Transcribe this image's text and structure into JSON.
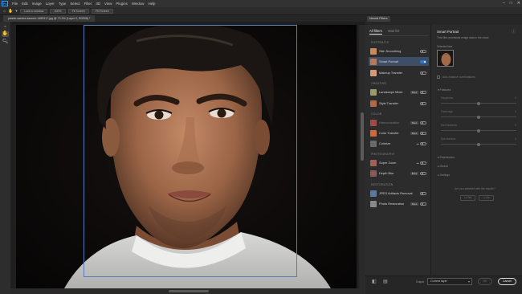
{
  "menubar": {
    "items": [
      "File",
      "Edit",
      "Image",
      "Layer",
      "Type",
      "Select",
      "Filter",
      "3D",
      "View",
      "Plugins",
      "Window",
      "Help"
    ]
  },
  "optionsbar": {
    "buttons": [
      "Lock to window",
      "100%",
      "Fit Screen",
      "Fill Screen"
    ]
  },
  "document": {
    "tab_title": "plastic-sandra-kazemi-1489317.jpg @ 73.3% (Layer 0, RGB/8) *"
  },
  "neural_filters": {
    "panel_title": "Neural Filters",
    "tabs": [
      "All filters",
      "Wait list"
    ],
    "categories": {
      "portraits": "PORTRAITS",
      "creative": "CREATIVE",
      "color": "COLOR",
      "photography": "PHOTOGRAPHY",
      "restoration": "RESTORATION"
    },
    "filters": [
      {
        "label": "Skin Smoothing",
        "thumb": "#c88a5a",
        "beta": "",
        "on": false,
        "selected": false
      },
      {
        "label": "Smart Portrait",
        "thumb": "#b57a58",
        "beta": "",
        "on": true,
        "selected": true
      },
      {
        "label": "Makeup Transfer",
        "thumb": "#d49a7a",
        "beta": "",
        "on": false,
        "selected": false
      },
      {
        "label": "Landscape Mixer",
        "thumb": "#9a9a6a",
        "beta": "Beta",
        "on": false,
        "selected": false
      },
      {
        "label": "Style Transfer",
        "thumb": "#b06a4a",
        "beta": "",
        "on": false,
        "selected": false
      },
      {
        "label": "Harmonization",
        "thumb": "#a04a4a",
        "beta": "Beta",
        "on": false,
        "selected": false
      },
      {
        "label": "Color Transfer",
        "thumb": "#d06a3a",
        "beta": "Beta",
        "on": false,
        "selected": false
      },
      {
        "label": "Colorize",
        "thumb": "#6a6a6a",
        "beta": "",
        "on": false,
        "selected": false
      },
      {
        "label": "Super Zoom",
        "thumb": "#a0605a",
        "beta": "",
        "on": false,
        "selected": false
      },
      {
        "label": "Depth Blur",
        "thumb": "#8a5a5a",
        "beta": "Beta",
        "on": false,
        "selected": false
      },
      {
        "label": "JPEG Artifacts Removal",
        "thumb": "#5a7aa0",
        "beta": "",
        "on": false,
        "selected": false
      },
      {
        "label": "Photo Restoration",
        "thumb": "#8a8a8a",
        "beta": "Beta",
        "on": false,
        "selected": false
      }
    ],
    "settings": {
      "title": "Smart Portrait",
      "description": "This filter processes image data in the cloud.",
      "selected_face_label": "Selected face",
      "auto_balance": "Auto balance combinations",
      "featured_section": "Featured",
      "sliders": [
        {
          "label": "Happiness",
          "value": "0"
        },
        {
          "label": "Facial age",
          "value": "0"
        },
        {
          "label": "Hair thickness",
          "value": "0"
        },
        {
          "label": "Eye direction",
          "value": "0"
        }
      ],
      "expressions_section": "Expressions",
      "global_section": "Global",
      "settings_section": "Settings",
      "feedback_question": "Are you satisfied with the results?",
      "feedback_yes": "Yes",
      "feedback_no": "No"
    },
    "bottom": {
      "output_label": "Output",
      "output_value": "Current layer",
      "ok_label": "OK",
      "cancel_label": "Cancel"
    }
  }
}
